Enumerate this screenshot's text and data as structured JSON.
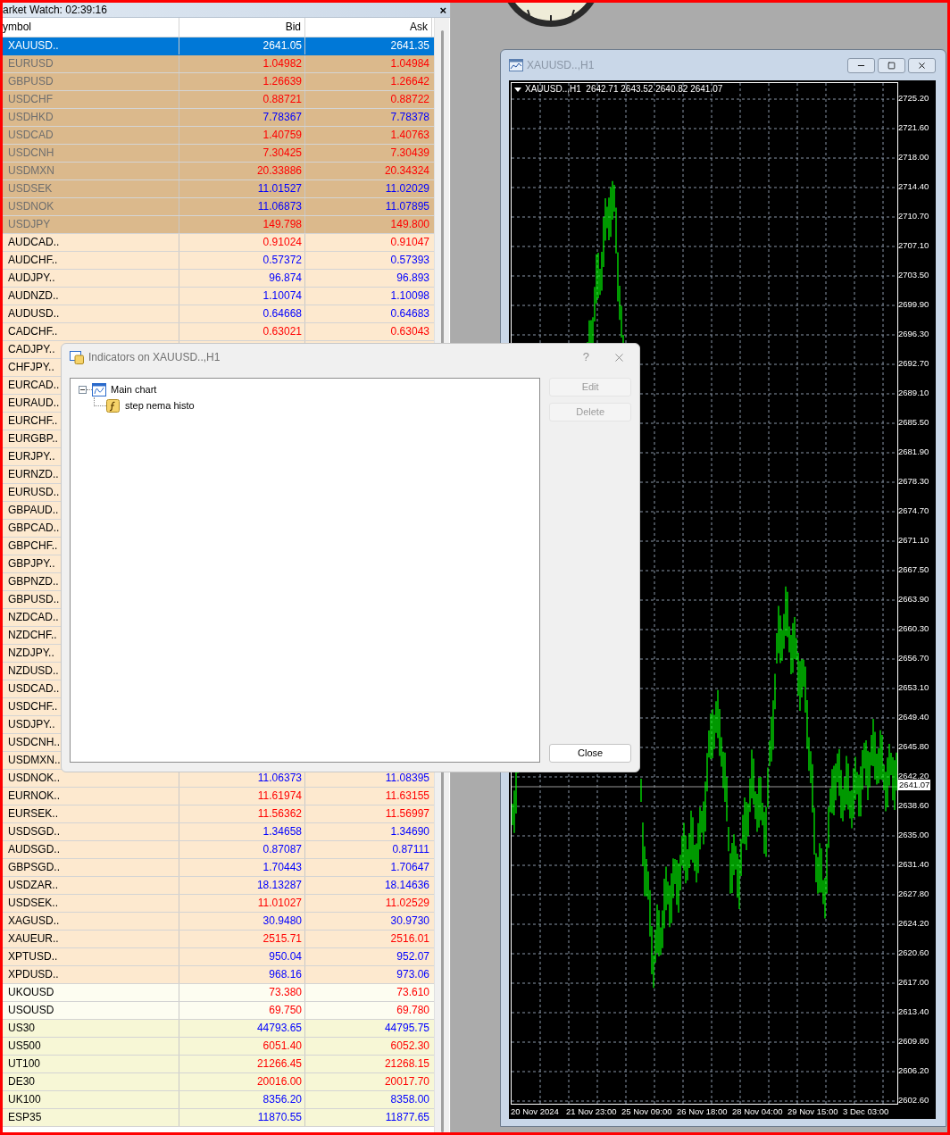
{
  "market_watch": {
    "title": "arket Watch: 02:39:16",
    "close": "×",
    "columns": [
      "ymbol",
      "Bid",
      "Ask"
    ],
    "rows": [
      {
        "symbol": "XAUUSD..",
        "bid": {
          "text": "2641.05"
        },
        "ask": {
          "text": "2641.35"
        },
        "color": "#0078d7",
        "disabled": false,
        "selected": true
      },
      {
        "symbol": "EURUSD",
        "bid": {
          "text": "1.04982",
          "color": "#ff0000"
        },
        "ask": {
          "text": "1.04984",
          "color": "#ff0000"
        },
        "color": "#dbb98c",
        "disabled": true,
        "selected": false
      },
      {
        "symbol": "GBPUSD",
        "bid": {
          "text": "1.26639",
          "color": "#ff0000"
        },
        "ask": {
          "text": "1.26642",
          "color": "#ff0000"
        },
        "color": "#dbb98c",
        "disabled": true,
        "selected": false
      },
      {
        "symbol": "USDCHF",
        "bid": {
          "text": "0.88721",
          "color": "#ff0000"
        },
        "ask": {
          "text": "0.88722",
          "color": "#ff0000"
        },
        "color": "#dbb98c",
        "disabled": true,
        "selected": false
      },
      {
        "symbol": "USDHKD",
        "bid": {
          "text": "7.78367",
          "color": "#0000ff"
        },
        "ask": {
          "text": "7.78378",
          "color": "#0000ff"
        },
        "color": "#dbb98c",
        "disabled": true,
        "selected": false
      },
      {
        "symbol": "USDCAD",
        "bid": {
          "text": "1.40759",
          "color": "#ff0000"
        },
        "ask": {
          "text": "1.40763",
          "color": "#ff0000"
        },
        "color": "#dbb98c",
        "disabled": true,
        "selected": false
      },
      {
        "symbol": "USDCNH",
        "bid": {
          "text": "7.30425",
          "color": "#ff0000"
        },
        "ask": {
          "text": "7.30439",
          "color": "#ff0000"
        },
        "color": "#dbb98c",
        "disabled": true,
        "selected": false
      },
      {
        "symbol": "USDMXN",
        "bid": {
          "text": "20.33886",
          "color": "#ff0000"
        },
        "ask": {
          "text": "20.34324",
          "color": "#ff0000"
        },
        "color": "#dbb98c",
        "disabled": true,
        "selected": false
      },
      {
        "symbol": "USDSEK",
        "bid": {
          "text": "11.01527",
          "color": "#0000ff"
        },
        "ask": {
          "text": "11.02029",
          "color": "#0000ff"
        },
        "color": "#dbb98c",
        "disabled": true,
        "selected": false
      },
      {
        "symbol": "USDNOK",
        "bid": {
          "text": "11.06873",
          "color": "#0000ff"
        },
        "ask": {
          "text": "11.07895",
          "color": "#0000ff"
        },
        "color": "#dbb98c",
        "disabled": true,
        "selected": false
      },
      {
        "symbol": "USDJPY",
        "bid": {
          "text": "149.798",
          "color": "#ff0000"
        },
        "ask": {
          "text": "149.800",
          "color": "#ff0000"
        },
        "color": "#dbb98c",
        "disabled": true,
        "selected": false
      },
      {
        "symbol": "AUDCAD..",
        "bid": {
          "text": "0.91024",
          "color": "#ff0000"
        },
        "ask": {
          "text": "0.91047",
          "color": "#ff0000"
        },
        "color": "#fde9cf",
        "disabled": false,
        "selected": false
      },
      {
        "symbol": "AUDCHF..",
        "bid": {
          "text": "0.57372",
          "color": "#0000ff"
        },
        "ask": {
          "text": "0.57393",
          "color": "#0000ff"
        },
        "color": "#fde9cf",
        "disabled": false,
        "selected": false
      },
      {
        "symbol": "AUDJPY..",
        "bid": {
          "text": "96.874",
          "color": "#0000ff"
        },
        "ask": {
          "text": "96.893",
          "color": "#0000ff"
        },
        "color": "#fde9cf",
        "disabled": false,
        "selected": false
      },
      {
        "symbol": "AUDNZD..",
        "bid": {
          "text": "1.10074",
          "color": "#0000ff"
        },
        "ask": {
          "text": "1.10098",
          "color": "#0000ff"
        },
        "color": "#fde9cf",
        "disabled": false,
        "selected": false
      },
      {
        "symbol": "AUDUSD..",
        "bid": {
          "text": "0.64668",
          "color": "#0000ff"
        },
        "ask": {
          "text": "0.64683",
          "color": "#0000ff"
        },
        "color": "#fde9cf",
        "disabled": false,
        "selected": false
      },
      {
        "symbol": "CADCHF..",
        "bid": {
          "text": "0.63021",
          "color": "#ff0000"
        },
        "ask": {
          "text": "0.63043",
          "color": "#ff0000"
        },
        "color": "#fde9cf",
        "disabled": false,
        "selected": false
      },
      {
        "symbol": "CADJPY..",
        "color": "#fde9cf",
        "disabled": false,
        "selected": false
      },
      {
        "symbol": "CHFJPY..",
        "color": "#fde9cf",
        "disabled": false,
        "selected": false
      },
      {
        "symbol": "EURCAD..",
        "color": "#fde9cf",
        "disabled": false,
        "selected": false
      },
      {
        "symbol": "EURAUD..",
        "color": "#fde9cf",
        "disabled": false,
        "selected": false
      },
      {
        "symbol": "EURCHF..",
        "color": "#fde9cf",
        "disabled": false,
        "selected": false
      },
      {
        "symbol": "EURGBP..",
        "color": "#fde9cf",
        "disabled": false,
        "selected": false
      },
      {
        "symbol": "EURJPY..",
        "color": "#fde9cf",
        "disabled": false,
        "selected": false
      },
      {
        "symbol": "EURNZD..",
        "color": "#fde9cf",
        "disabled": false,
        "selected": false
      },
      {
        "symbol": "EURUSD..",
        "color": "#fde9cf",
        "disabled": false,
        "selected": false
      },
      {
        "symbol": "GBPAUD..",
        "color": "#fde9cf",
        "disabled": false,
        "selected": false
      },
      {
        "symbol": "GBPCAD..",
        "color": "#fde9cf",
        "disabled": false,
        "selected": false
      },
      {
        "symbol": "GBPCHF..",
        "color": "#fde9cf",
        "disabled": false,
        "selected": false
      },
      {
        "symbol": "GBPJPY..",
        "color": "#fde9cf",
        "disabled": false,
        "selected": false
      },
      {
        "symbol": "GBPNZD..",
        "color": "#fde9cf",
        "disabled": false,
        "selected": false
      },
      {
        "symbol": "GBPUSD..",
        "color": "#fde9cf",
        "disabled": false,
        "selected": false
      },
      {
        "symbol": "NZDCAD..",
        "color": "#fde9cf",
        "disabled": false,
        "selected": false
      },
      {
        "symbol": "NZDCHF..",
        "color": "#fde9cf",
        "disabled": false,
        "selected": false
      },
      {
        "symbol": "NZDJPY..",
        "color": "#fde9cf",
        "disabled": false,
        "selected": false
      },
      {
        "symbol": "NZDUSD..",
        "color": "#fde9cf",
        "disabled": false,
        "selected": false
      },
      {
        "symbol": "USDCAD..",
        "color": "#fde9cf",
        "disabled": false,
        "selected": false
      },
      {
        "symbol": "USDCHF..",
        "color": "#fde9cf",
        "disabled": false,
        "selected": false
      },
      {
        "symbol": "USDJPY..",
        "color": "#fde9cf",
        "disabled": false,
        "selected": false
      },
      {
        "symbol": "USDCNH..",
        "color": "#fde9cf",
        "disabled": false,
        "selected": false
      },
      {
        "symbol": "USDMXN..",
        "color": "#fde9cf",
        "disabled": false,
        "selected": false
      },
      {
        "symbol": "USDNOK..",
        "bid": {
          "text": "11.06373",
          "color": "#0000ff"
        },
        "ask": {
          "text": "11.08395",
          "color": "#0000ff"
        },
        "color": "#fde9cf",
        "disabled": false,
        "selected": false
      },
      {
        "symbol": "EURNOK..",
        "bid": {
          "text": "11.61974",
          "color": "#ff0000"
        },
        "ask": {
          "text": "11.63155",
          "color": "#ff0000"
        },
        "color": "#fde9cf",
        "disabled": false,
        "selected": false
      },
      {
        "symbol": "EURSEK..",
        "bid": {
          "text": "11.56362",
          "color": "#ff0000"
        },
        "ask": {
          "text": "11.56997",
          "color": "#ff0000"
        },
        "color": "#fde9cf",
        "disabled": false,
        "selected": false
      },
      {
        "symbol": "USDSGD..",
        "bid": {
          "text": "1.34658",
          "color": "#0000ff"
        },
        "ask": {
          "text": "1.34690",
          "color": "#0000ff"
        },
        "color": "#fde9cf",
        "disabled": false,
        "selected": false
      },
      {
        "symbol": "AUDSGD..",
        "bid": {
          "text": "0.87087",
          "color": "#0000ff"
        },
        "ask": {
          "text": "0.87111",
          "color": "#0000ff"
        },
        "color": "#fde9cf",
        "disabled": false,
        "selected": false
      },
      {
        "symbol": "GBPSGD..",
        "bid": {
          "text": "1.70443",
          "color": "#0000ff"
        },
        "ask": {
          "text": "1.70647",
          "color": "#0000ff"
        },
        "color": "#fde9cf",
        "disabled": false,
        "selected": false
      },
      {
        "symbol": "USDZAR..",
        "bid": {
          "text": "18.13287",
          "color": "#0000ff"
        },
        "ask": {
          "text": "18.14636",
          "color": "#0000ff"
        },
        "color": "#fde9cf",
        "disabled": false,
        "selected": false
      },
      {
        "symbol": "USDSEK..",
        "bid": {
          "text": "11.01027",
          "color": "#ff0000"
        },
        "ask": {
          "text": "11.02529",
          "color": "#ff0000"
        },
        "color": "#fde9cf",
        "disabled": false,
        "selected": false
      },
      {
        "symbol": "XAGUSD..",
        "bid": {
          "text": "30.9480",
          "color": "#0000ff"
        },
        "ask": {
          "text": "30.9730",
          "color": "#0000ff"
        },
        "color": "#fde9cf",
        "disabled": false,
        "selected": false
      },
      {
        "symbol": "XAUEUR..",
        "bid": {
          "text": "2515.71",
          "color": "#ff0000"
        },
        "ask": {
          "text": "2516.01",
          "color": "#ff0000"
        },
        "color": "#fde9cf",
        "disabled": false,
        "selected": false
      },
      {
        "symbol": "XPTUSD..",
        "bid": {
          "text": "950.04",
          "color": "#0000ff"
        },
        "ask": {
          "text": "952.07",
          "color": "#0000ff"
        },
        "color": "#fde9cf",
        "disabled": false,
        "selected": false
      },
      {
        "symbol": "XPDUSD..",
        "bid": {
          "text": "968.16",
          "color": "#0000ff"
        },
        "ask": {
          "text": "973.06",
          "color": "#0000ff"
        },
        "color": "#fde9cf",
        "disabled": false,
        "selected": false
      },
      {
        "symbol": "UKOUSD",
        "bid": {
          "text": "73.380",
          "color": "#ff0000"
        },
        "ask": {
          "text": "73.610",
          "color": "#ff0000"
        },
        "color": "#fdfdf1",
        "disabled": false,
        "selected": false
      },
      {
        "symbol": "USOUSD",
        "bid": {
          "text": "69.750",
          "color": "#ff0000"
        },
        "ask": {
          "text": "69.780",
          "color": "#ff0000"
        },
        "color": "#fdfdf1",
        "disabled": false,
        "selected": false
      },
      {
        "symbol": "US30",
        "bid": {
          "text": "44793.65",
          "color": "#0000ff"
        },
        "ask": {
          "text": "44795.75",
          "color": "#0000ff"
        },
        "color": "#f7f7d6",
        "disabled": false,
        "selected": false
      },
      {
        "symbol": "US500",
        "bid": {
          "text": "6051.40",
          "color": "#ff0000"
        },
        "ask": {
          "text": "6052.30",
          "color": "#ff0000"
        },
        "color": "#f7f7d6",
        "disabled": false,
        "selected": false
      },
      {
        "symbol": "UT100",
        "bid": {
          "text": "21266.45",
          "color": "#ff0000"
        },
        "ask": {
          "text": "21268.15",
          "color": "#ff0000"
        },
        "color": "#f7f7d6",
        "disabled": false,
        "selected": false
      },
      {
        "symbol": "DE30",
        "bid": {
          "text": "20016.00",
          "color": "#ff0000"
        },
        "ask": {
          "text": "20017.70",
          "color": "#ff0000"
        },
        "color": "#f7f7d6",
        "disabled": false,
        "selected": false
      },
      {
        "symbol": "UK100",
        "bid": {
          "text": "8356.20",
          "color": "#0000ff"
        },
        "ask": {
          "text": "8358.00",
          "color": "#0000ff"
        },
        "color": "#f7f7d6",
        "disabled": false,
        "selected": false
      },
      {
        "symbol": "ESP35",
        "bid": {
          "text": "11870.55",
          "color": "#0000ff"
        },
        "ask": {
          "text": "11877.65",
          "color": "#0000ff"
        },
        "color": "#f7f7d6",
        "disabled": false,
        "selected": false
      }
    ]
  },
  "chart_window": {
    "title": "XAUUSD..,H1",
    "legend": "XAUUSD..,H1  2642.71 2643.52 2640.82 2641.07",
    "current_price": "2641.07",
    "price_labels": [
      "2725.20",
      "2721.60",
      "2718.00",
      "2714.40",
      "2710.70",
      "2707.10",
      "2703.50",
      "2699.90",
      "2696.30",
      "2692.70",
      "2689.10",
      "2685.50",
      "2681.90",
      "2678.30",
      "2674.70",
      "2671.10",
      "2667.50",
      "2663.90",
      "2660.30",
      "2656.70",
      "2653.10",
      "2649.40",
      "2645.80",
      "2642.20",
      "2638.60",
      "2635.00",
      "2631.40",
      "2627.80",
      "2624.20",
      "2620.60",
      "2617.00",
      "2613.40",
      "2609.80",
      "2606.20",
      "2602.60"
    ],
    "time_labels": [
      "20 Nov 2024",
      "21 Nov 23:00",
      "25 Nov 09:00",
      "26 Nov 18:00",
      "28 Nov 04:00",
      "29 Nov 15:00",
      "3 Dec 03:00"
    ]
  },
  "dialog": {
    "title": "Indicators on XAUUSD..,H1",
    "help": "?",
    "tree": [
      {
        "label": "Main chart",
        "expanded": true,
        "children": [
          {
            "label": "step nema histo"
          }
        ]
      }
    ],
    "buttons": [
      {
        "label": "Edit",
        "disabled": true
      },
      {
        "label": "Delete",
        "disabled": true
      },
      {
        "label": "Close",
        "disabled": false
      }
    ]
  }
}
